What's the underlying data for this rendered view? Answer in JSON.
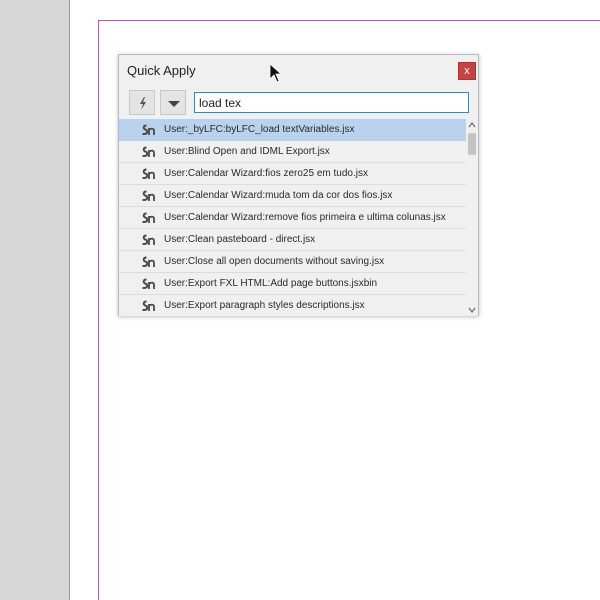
{
  "panel": {
    "title": "Quick Apply",
    "close_label": "x"
  },
  "toolbar": {
    "bolt_icon": "lightning-bolt-icon",
    "menu_icon": "dropdown-triangle-icon"
  },
  "search": {
    "value": "load tex",
    "focus_color": "#2a8cd0"
  },
  "results": {
    "selected_index": 0,
    "selected_color": "#b9d3ee",
    "item_icon": "script-icon",
    "items": [
      {
        "label": "User:_byLFC:byLFC_load textVariables.jsx"
      },
      {
        "label": "User:Blind Open and IDML Export.jsx"
      },
      {
        "label": "User:Calendar Wizard:fios zero25 em tudo.jsx"
      },
      {
        "label": "User:Calendar Wizard:muda tom da cor dos fios.jsx"
      },
      {
        "label": "User:Calendar Wizard:remove fios primeira e ultima colunas.jsx"
      },
      {
        "label": "User:Clean pasteboard - direct.jsx"
      },
      {
        "label": "User:Close all open documents without saving.jsx"
      },
      {
        "label": "User:Export FXL HTML:Add page buttons.jsxbin"
      },
      {
        "label": "User:Export paragraph styles descriptions.jsx"
      }
    ]
  },
  "colors": {
    "close_button": "#c74343",
    "margin_guide": "#c451c4",
    "pasteboard": "#d7d7d7"
  }
}
